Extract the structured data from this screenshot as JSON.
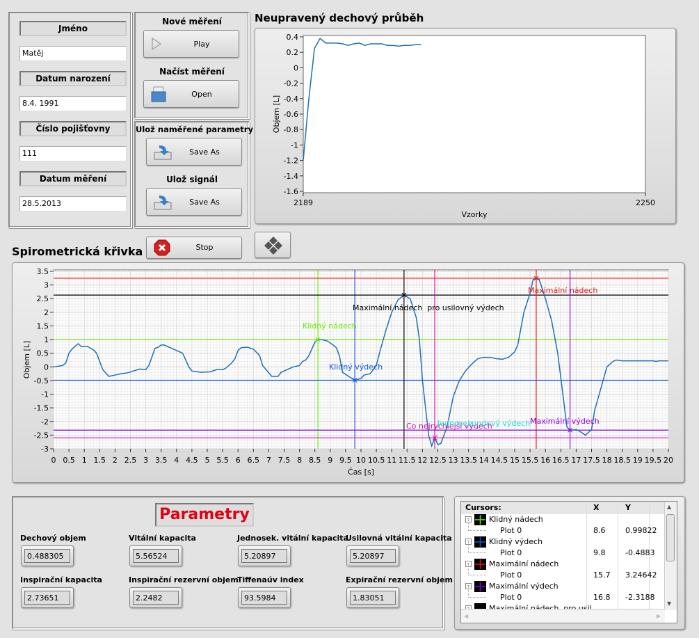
{
  "patient": {
    "name_label": "Jméno",
    "name": "Matěj",
    "birth_label": "Datum narození",
    "birth": "8.4. 1991",
    "insurance_label": "Číslo pojišťovny",
    "insurance": "111",
    "date_label": "Datum měření",
    "date": "28.5.2013"
  },
  "actions": {
    "new_label": "Nové měření",
    "play": "Play",
    "load_label": "Načíst měření",
    "open": "Open",
    "save_params_label": "Ulož naměřené parametry",
    "save_as": "Save As",
    "save_signal_label": "Ulož signál",
    "stop": "Stop"
  },
  "raw_chart": {
    "title": "Neupravený dechový průběh",
    "xlabel": "Vzorky",
    "ylabel": "Objem [L]",
    "xlim": [
      2189,
      2250
    ],
    "ylim": [
      -1.6,
      0.4
    ],
    "yticks": [
      "0.4",
      "0.2",
      "0",
      "-0.2",
      "-0.4",
      "-0.6",
      "-0.8",
      "-1",
      "-1.2",
      "-1.4",
      "-1.6"
    ],
    "xticks": [
      "2189",
      "2250"
    ],
    "color": "#1f6fb5",
    "x": [
      2189,
      2190,
      2191,
      2192,
      2193,
      2194,
      2195,
      2196,
      2197,
      2198,
      2199,
      2200,
      2201,
      2202,
      2203,
      2204,
      2205,
      2206,
      2207,
      2208,
      2209,
      2210
    ],
    "y": [
      -1.2,
      -0.4,
      0.25,
      0.38,
      0.32,
      0.32,
      0.32,
      0.31,
      0.29,
      0.31,
      0.32,
      0.29,
      0.31,
      0.31,
      0.31,
      0.29,
      0.29,
      0.28,
      0.29,
      0.29,
      0.3,
      0.3
    ]
  },
  "chart_data": {
    "type": "line",
    "title": "Spirometrická křivka",
    "xlabel": "Čas [s]",
    "ylabel": "Objem [L]",
    "xlim": [
      0,
      20
    ],
    "ylim": [
      -3,
      3.5
    ],
    "grid": true,
    "color": "#1f6fb5",
    "xticks": [
      "0",
      "0.5",
      "1",
      "1.5",
      "2",
      "2.5",
      "3",
      "3.5",
      "4",
      "4.5",
      "5",
      "5.5",
      "6",
      "6.5",
      "7",
      "7.5",
      "8",
      "8.5",
      "9",
      "9.5",
      "10",
      "10.5",
      "11",
      "11.5",
      "12",
      "12.5",
      "13",
      "13.5",
      "14",
      "14.5",
      "15",
      "15.5",
      "16",
      "16.5",
      "17",
      "17.5",
      "18",
      "18.5",
      "19",
      "19.5",
      "20"
    ],
    "yticks": [
      "3.5",
      "3",
      "2.5",
      "2",
      "1.5",
      "1",
      "0.5",
      "0",
      "-0.5",
      "-1",
      "-1.5",
      "-2",
      "-2.5",
      "-3"
    ],
    "x": [
      0,
      0.3,
      0.4,
      0.5,
      0.6,
      0.8,
      0.9,
      1.1,
      1.3,
      1.4,
      1.6,
      1.8,
      2,
      2.2,
      2.4,
      2.6,
      2.8,
      3,
      3.1,
      3.3,
      3.4,
      3.5,
      3.6,
      3.8,
      3.9,
      4.2,
      4.4,
      4.5,
      4.8,
      5.1,
      5.3,
      5.5,
      5.6,
      5.8,
      5.9,
      6,
      6.1,
      6.3,
      6.5,
      6.7,
      6.8,
      7.1,
      7.3,
      7.4,
      7.6,
      7.8,
      8,
      8.1,
      8.2,
      8.3,
      8.5,
      8.6,
      8.7,
      8.9,
      9.1,
      9.2,
      9.3,
      9.4,
      9.6,
      9.8,
      10,
      10.1,
      10.3,
      10.5,
      10.6,
      10.8,
      11,
      11.2,
      11.4,
      11.6,
      11.8,
      11.9,
      12,
      12.1,
      12.2,
      12.3,
      12.4,
      12.5,
      12.6,
      12.8,
      13,
      13.2,
      13.4,
      13.6,
      13.8,
      14,
      14.2,
      14.4,
      14.6,
      14.8,
      15,
      15.1,
      15.3,
      15.5,
      15.6,
      15.7,
      15.8,
      16,
      16.2,
      16.4,
      16.6,
      16.7,
      16.8,
      17,
      17.1,
      17.3,
      17.5,
      17.6,
      17.8,
      18,
      18.2,
      18.3,
      18.5,
      19.5,
      19.6,
      19.7,
      20
    ],
    "y": [
      0,
      0.05,
      0.15,
      0.5,
      0.65,
      0.85,
      0.75,
      0.75,
      0.62,
      0.5,
      -0.1,
      -0.35,
      -0.3,
      -0.25,
      -0.22,
      -0.15,
      -0.08,
      -0.1,
      0.05,
      0.68,
      0.72,
      0.8,
      0.8,
      0.7,
      0.65,
      0.5,
      0,
      -0.15,
      -0.2,
      -0.18,
      -0.1,
      -0.1,
      -0.05,
      0.15,
      0.3,
      0.6,
      0.7,
      0.72,
      0.65,
      0.42,
      0.05,
      -0.35,
      -0.35,
      -0.2,
      -0.1,
      0,
      0.05,
      0.2,
      0.25,
      0.4,
      0.9,
      1,
      1,
      0.95,
      0.8,
      0.7,
      0.4,
      -0.2,
      -0.35,
      -0.49,
      -0.42,
      -0.3,
      -0.25,
      0.05,
      0.5,
      1.3,
      2,
      2.45,
      2.63,
      2.5,
      1.8,
      1,
      -0.5,
      -1.5,
      -2.5,
      -2.9,
      -2.6,
      -2.85,
      -2.8,
      -2.2,
      -1.1,
      -0.5,
      -0.15,
      0.1,
      0.3,
      0.35,
      0.35,
      0.3,
      0.28,
      0.35,
      0.55,
      0.8,
      2,
      2.7,
      3.2,
      3.25,
      3.2,
      2.5,
      1.7,
      0.5,
      -1.3,
      -2.2,
      -2.32,
      -2.3,
      -2.35,
      -2.5,
      -2.3,
      -1.6,
      -0.8,
      0,
      0.2,
      0.25,
      0.22,
      0.22,
      0.2,
      0.22,
      0.22
    ],
    "cursors": [
      {
        "name": "Klidný nádech",
        "x": 8.6,
        "y": 0.99822,
        "color": "#66ee00"
      },
      {
        "name": "Klidný výdech",
        "x": 9.8,
        "y": -0.4883,
        "color": "#1155dd"
      },
      {
        "name": "Maximální nádech  pro usilovný výdech",
        "x": 11.4,
        "y": 2.63,
        "color": "#000000"
      },
      {
        "name": "Co nejrychlejší výdech",
        "x": 12.4,
        "y": -2.6,
        "color": "#dd00aa"
      },
      {
        "name": "Jednosekundový výdech",
        "x": 12.4,
        "y": -2.6,
        "color": "#22dddd"
      },
      {
        "name": "Maximální nádech",
        "x": 15.7,
        "y": 3.24642,
        "color": "#ee1111"
      },
      {
        "name": "Maximální výdech",
        "x": 16.8,
        "y": -2.3188,
        "color": "#8800ee"
      }
    ]
  },
  "params": {
    "title": "Parametry",
    "items": [
      {
        "label": "Dechový objem",
        "value": "0.488305"
      },
      {
        "label": "Vitální kapacita",
        "value": "5.56524"
      },
      {
        "label": "Jednosek. vitální kapacita",
        "value": "5.20897"
      },
      {
        "label": "Usilovná vitální kapacita",
        "value": "5.20897"
      },
      {
        "label": "Inspirační kapacita",
        "value": "2.73651"
      },
      {
        "label": "Inspirační rezervní objem",
        "value": "2.2482"
      },
      {
        "label": "Tiffenaúv index",
        "value": "93.5984"
      },
      {
        "label": "Expirační rezervní objem",
        "value": "1.83051"
      }
    ]
  },
  "cursor_list": {
    "header": [
      "Cursors:",
      "X",
      "Y"
    ],
    "rows": [
      {
        "name": "Klidný nádech",
        "plot": "Plot 0",
        "x": "8.6",
        "y": "0.99822",
        "color": "#66ee00"
      },
      {
        "name": "Klidný výdech",
        "plot": "Plot 0",
        "x": "9.8",
        "y": "-0.4883",
        "color": "#1155dd"
      },
      {
        "name": "Maximální nádech",
        "plot": "Plot 0",
        "x": "15.7",
        "y": "3.24642",
        "color": "#ee1111"
      },
      {
        "name": "Maximální výdech",
        "plot": "Plot 0",
        "x": "16.8",
        "y": "-2.3188",
        "color": "#8800ee"
      },
      {
        "name": "Maximální nádech  pro usil",
        "color": "#000000"
      }
    ]
  }
}
